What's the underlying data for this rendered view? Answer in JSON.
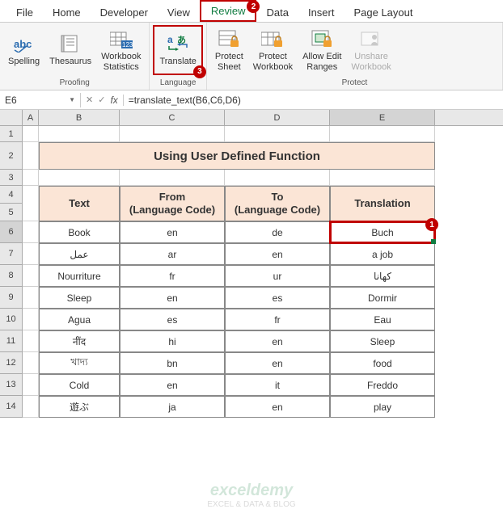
{
  "tabs": [
    "File",
    "Home",
    "Developer",
    "View",
    "Review",
    "Data",
    "Insert",
    "Page Layout"
  ],
  "active_tab": 4,
  "ribbon": {
    "proofing": {
      "label": "Proofing",
      "items": [
        "Spelling",
        "Thesaurus",
        "Workbook\nStatistics"
      ]
    },
    "language": {
      "label": "Language",
      "items": [
        "Translate"
      ]
    },
    "protect": {
      "label": "Protect",
      "items": [
        "Protect\nSheet",
        "Protect\nWorkbook",
        "Allow Edit\nRanges",
        "Unshare\nWorkbook"
      ]
    }
  },
  "namebox": "E6",
  "formula": "=translate_text(B6,C6,D6)",
  "columns": [
    "A",
    "B",
    "C",
    "D",
    "E"
  ],
  "title": "Using User Defined Function",
  "headers": [
    "Text",
    "From\n(Language Code)",
    "To\n(Language Code)",
    "Translation"
  ],
  "rows": [
    {
      "n": 6,
      "t": "Book",
      "f": "en",
      "to": "de",
      "tr": "Buch"
    },
    {
      "n": 7,
      "t": "عمل",
      "f": "ar",
      "to": "en",
      "tr": "a job"
    },
    {
      "n": 8,
      "t": "Nourriture",
      "f": "fr",
      "to": "ur",
      "tr": "کھانا"
    },
    {
      "n": 9,
      "t": "Sleep",
      "f": "en",
      "to": "es",
      "tr": "Dormir"
    },
    {
      "n": 10,
      "t": "Agua",
      "f": "es",
      "to": "fr",
      "tr": "Eau"
    },
    {
      "n": 11,
      "t": "नींद",
      "f": "hi",
      "to": "en",
      "tr": "Sleep"
    },
    {
      "n": 12,
      "t": "খাদ্য",
      "f": "bn",
      "to": "en",
      "tr": "food"
    },
    {
      "n": 13,
      "t": "Cold",
      "f": "en",
      "to": "it",
      "tr": "Freddo"
    },
    {
      "n": 14,
      "t": "遊ぶ",
      "f": "ja",
      "to": "en",
      "tr": "play"
    }
  ],
  "watermark": {
    "brand": "exceldemy",
    "tag": "EXCEL & DATA & BLOG"
  }
}
